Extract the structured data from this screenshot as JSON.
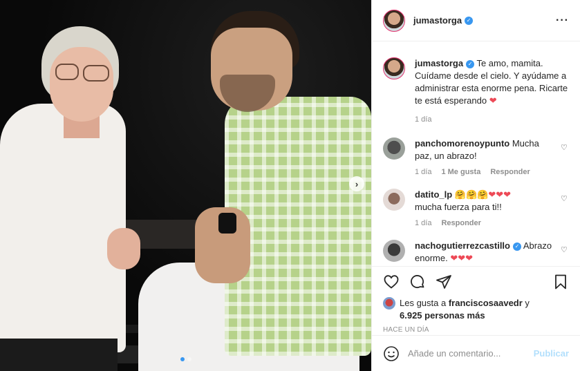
{
  "post": {
    "username": "jumastorga",
    "verified": true,
    "carousel": {
      "total": 2,
      "active": 0
    }
  },
  "caption": {
    "username": "jumastorga",
    "text": "Te amo, mamita. Cuídame desde el cielo. Y ayúdame a administrar esta enorme pena. Ricarte te está esperando",
    "emoji": "❤️",
    "time": "1 día"
  },
  "comments": [
    {
      "username": "panchomorenoypunto",
      "text": "Mucha paz, un abrazo!",
      "time": "1 día",
      "likes": "1 Me gusta",
      "reply": "Responder"
    },
    {
      "username": "datito_lp",
      "emojis": "🤗🤗🤗",
      "hearts": "❤❤❤",
      "text": "mucha fuerza para ti!!",
      "time": "1 día",
      "reply": "Responder"
    },
    {
      "username": "nachogutierrezcastillo",
      "verified": true,
      "text": "Abrazo enorme.",
      "hearts": "❤❤❤"
    }
  ],
  "likes": {
    "prefix": "Les gusta a",
    "user": "franciscosaavedr",
    "conj": "y",
    "count": "6.925 personas más"
  },
  "posted": "HACE UN DÍA",
  "add_comment": {
    "placeholder": "Añade un comentario...",
    "button": "Publicar"
  },
  "icons": {
    "more": "more-icon",
    "like": "heart-icon",
    "comment": "comment-icon",
    "share": "share-icon",
    "save": "bookmark-icon",
    "emoji": "emoji-icon"
  },
  "colors": {
    "verified": "#3897f0",
    "heart": "#ed4956",
    "publish": "#b2dffc",
    "muted": "#8e8e8e"
  }
}
